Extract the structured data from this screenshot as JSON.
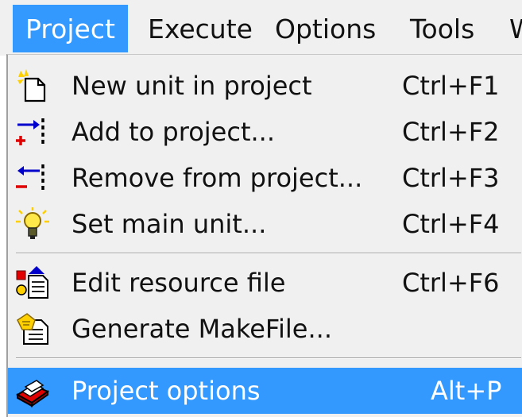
{
  "menubar": {
    "items": [
      {
        "label": "Project"
      },
      {
        "label": "Execute"
      },
      {
        "label": "Options"
      },
      {
        "label": "Tools"
      },
      {
        "label": "W"
      }
    ]
  },
  "menu": {
    "items": [
      {
        "label": "New unit in project",
        "shortcut": "Ctrl+F1",
        "icon": "new-file-icon"
      },
      {
        "label": "Add to project...",
        "shortcut": "Ctrl+F2",
        "icon": "add-to-project-icon"
      },
      {
        "label": "Remove from project...",
        "shortcut": "Ctrl+F3",
        "icon": "remove-from-project-icon"
      },
      {
        "label": "Set main unit...",
        "shortcut": "Ctrl+F4",
        "icon": "lightbulb-icon"
      },
      {
        "label": "Edit resource file",
        "shortcut": "Ctrl+F6",
        "icon": "resource-file-icon"
      },
      {
        "label": "Generate MakeFile...",
        "shortcut": "",
        "icon": "makefile-icon"
      },
      {
        "label": "Project options",
        "shortcut": "Alt+P",
        "icon": "project-options-icon"
      }
    ]
  },
  "colors": {
    "highlight": "#3399ff",
    "menu_background": "#f0f0f0"
  }
}
